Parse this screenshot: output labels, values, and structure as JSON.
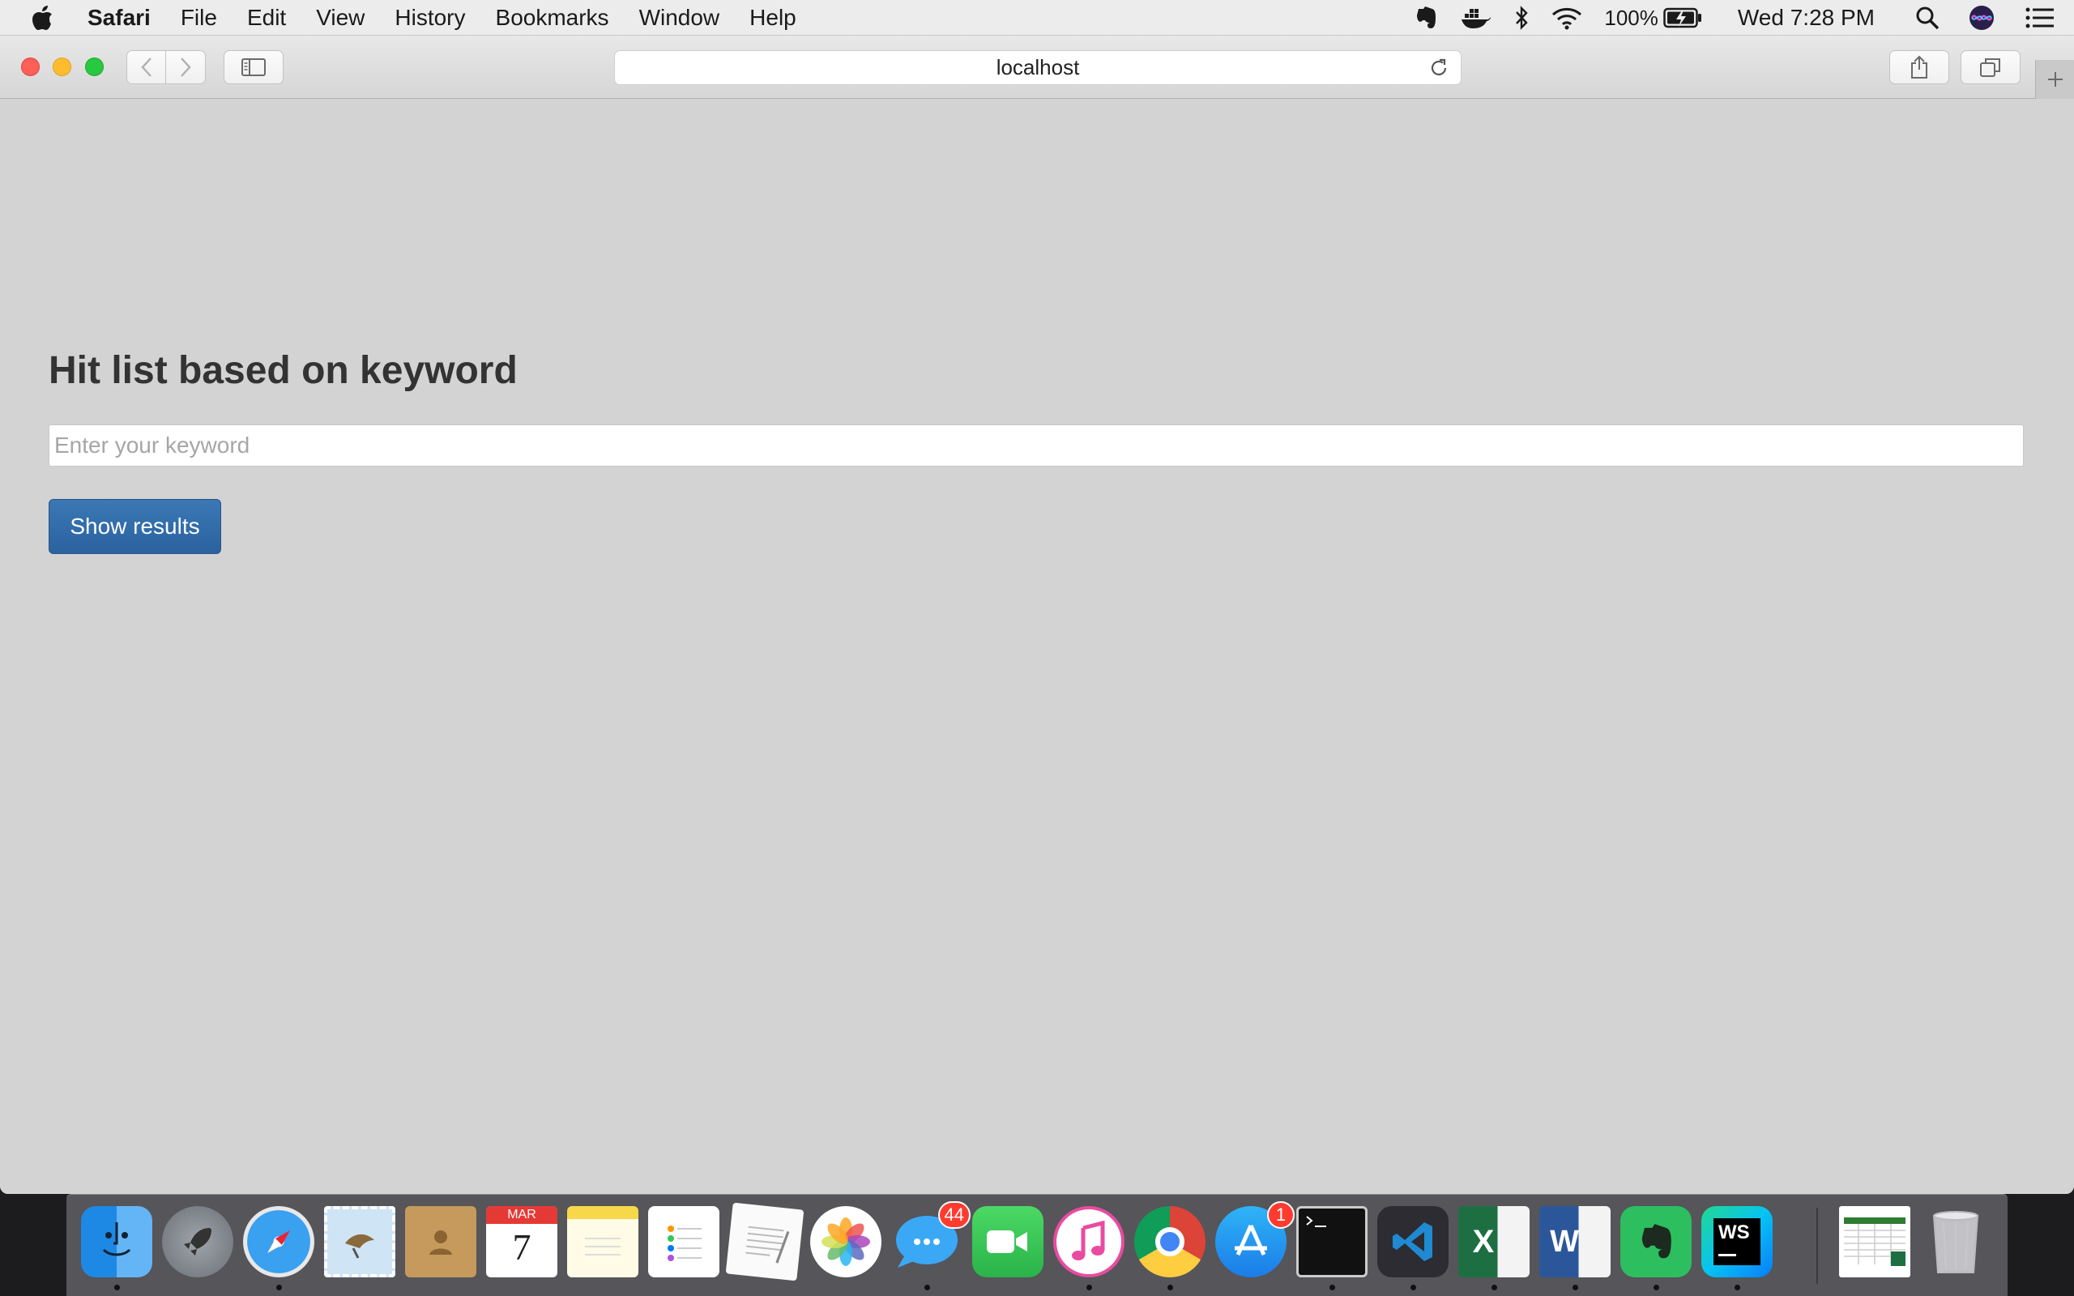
{
  "menubar": {
    "app_name": "Safari",
    "menus": [
      "File",
      "Edit",
      "View",
      "History",
      "Bookmarks",
      "Window",
      "Help"
    ],
    "battery": "100%",
    "clock": "Wed 7:28 PM"
  },
  "browser": {
    "address": "localhost"
  },
  "page": {
    "title": "Hit list based on keyword",
    "keyword_placeholder": "Enter your keyword",
    "keyword_value": "",
    "button_label": "Show results"
  },
  "dock": {
    "messages_badge": "44",
    "appstore_badge": "1",
    "calendar_month": "MAR",
    "calendar_day": "7",
    "items": [
      "finder",
      "launchpad",
      "safari",
      "mail",
      "contacts",
      "calendar",
      "notes",
      "reminders",
      "textedit",
      "photos",
      "messages",
      "facetime",
      "itunes",
      "chrome",
      "app-store",
      "terminal",
      "vscode",
      "excel",
      "word",
      "evernote",
      "webstorm",
      "excel-document",
      "trash"
    ]
  },
  "colors": {
    "page_background": "#d3d3d3",
    "button_primary": "#2f6ba8",
    "title_text": "#333333"
  }
}
